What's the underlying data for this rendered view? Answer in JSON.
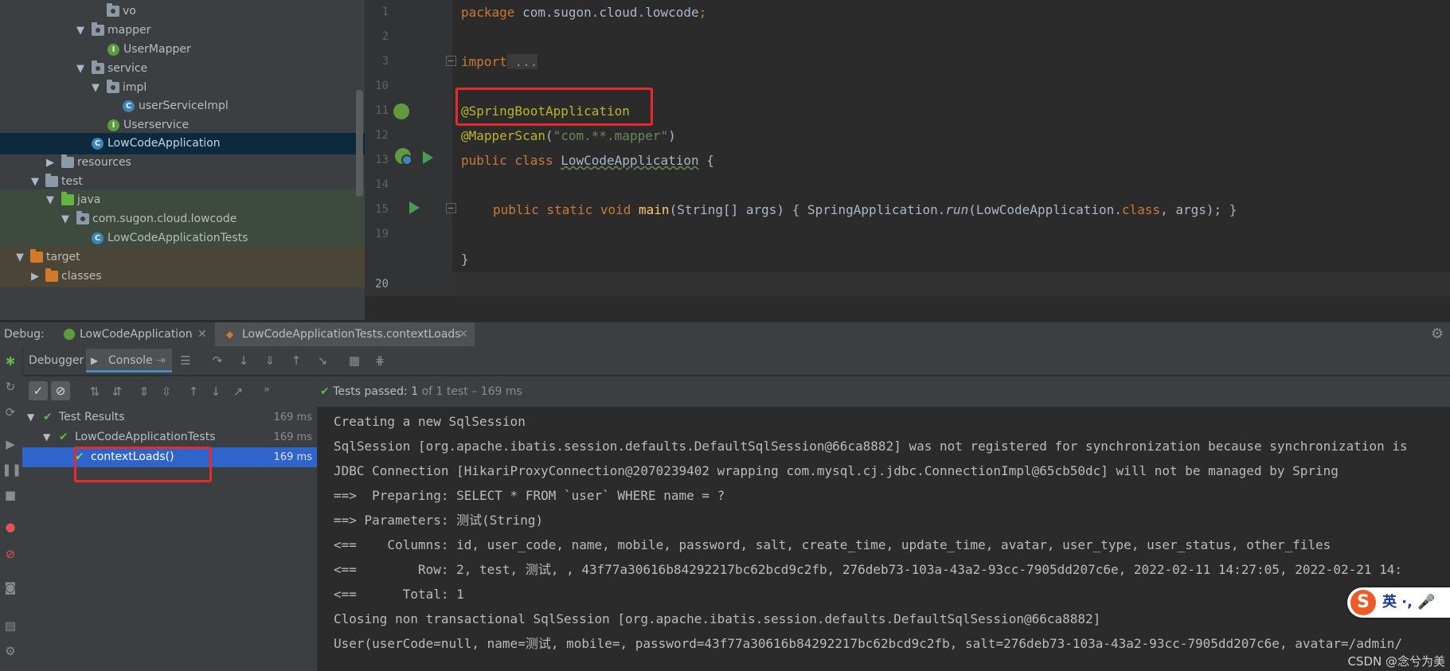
{
  "tree": {
    "items": [
      {
        "label": "vo",
        "icon": "package-folder-icon"
      },
      {
        "label": "mapper",
        "icon": "package-folder-icon"
      },
      {
        "label": "UserMapper",
        "icon": "interface-icon"
      },
      {
        "label": "service",
        "icon": "package-folder-icon"
      },
      {
        "label": "impl",
        "icon": "package-folder-icon"
      },
      {
        "label": "userServiceImpl",
        "icon": "class-icon"
      },
      {
        "label": "Userservice",
        "icon": "interface-icon"
      },
      {
        "label": "LowCodeApplication",
        "icon": "spring-boot-class-icon"
      },
      {
        "label": "resources",
        "icon": "resources-folder-icon"
      },
      {
        "label": "test",
        "icon": "folder-icon"
      },
      {
        "label": "java",
        "icon": "test-source-folder-icon"
      },
      {
        "label": "com.sugon.cloud.lowcode",
        "icon": "package-folder-icon"
      },
      {
        "label": "LowCodeApplicationTests",
        "icon": "spring-boot-class-icon"
      },
      {
        "label": "target",
        "icon": "excluded-folder-icon"
      },
      {
        "label": "classes",
        "icon": "excluded-folder-icon"
      }
    ]
  },
  "editor": {
    "line_numbers": [
      "1",
      "2",
      "3",
      "10",
      "11",
      "12",
      "13",
      "14",
      "15",
      "19",
      "20"
    ],
    "lines": {
      "package_kw": "package",
      "package_name": " com.sugon.cloud.lowcode",
      "semicolon": ";",
      "import_kw": "import",
      "import_folded": " ...",
      "annotation_springboot": "@SpringBootApplication",
      "annotation_mapperscan": "@MapperScan",
      "mapperscan_open": "(",
      "mapperscan_str": "\"com.**.mapper\"",
      "mapperscan_close": ")",
      "class_mods": "public class",
      "class_name": "LowCodeApplication",
      "class_brace": " {",
      "main_mods": "public static void",
      "main_name": "main",
      "main_params": "(String[] args) { SpringApplication.",
      "run_call": "run",
      "main_args_a": "(LowCodeApplication.",
      "class_kw": "class",
      "main_args_b": ", args); }",
      "closing_brace": "}"
    }
  },
  "debug": {
    "label": "Debug:",
    "tabs": [
      "LowCodeApplication",
      "LowCodeApplicationTests.contextLoads"
    ],
    "sub_tabs": {
      "debugger": "Debugger",
      "console": "Console"
    }
  },
  "testbar": {
    "status_prefix": "Tests passed:",
    "status_count": "1",
    "status_of": "of 1 test",
    "status_time": "– 169 ms"
  },
  "results": {
    "rows": [
      {
        "label": "Test Results",
        "time": "169 ms"
      },
      {
        "label": "LowCodeApplicationTests",
        "time": "169 ms"
      },
      {
        "label": "contextLoads()",
        "time": "169 ms"
      }
    ]
  },
  "console": {
    "lines": [
      "Creating a new SqlSession",
      "SqlSession [org.apache.ibatis.session.defaults.DefaultSqlSession@66ca8882] was not registered for synchronization because synchronization is",
      "JDBC Connection [HikariProxyConnection@2070239402 wrapping com.mysql.cj.jdbc.ConnectionImpl@65cb50dc] will not be managed by Spring",
      "==>  Preparing: SELECT * FROM `user` WHERE name = ?",
      "==> Parameters: 测试(String)",
      "<==    Columns: id, user_code, name, mobile, password, salt, create_time, update_time, avatar, user_type, user_status, other_files",
      "<==        Row: 2, test, 测试, , 43f77a30616b84292217bc62bcd9c2fb, 276deb73-103a-43a2-93cc-7905dd207c6e, 2022-02-11 14:27:05, 2022-02-21 14:",
      "<==      Total: 1",
      "Closing non transactional SqlSession [org.apache.ibatis.session.defaults.DefaultSqlSession@66ca8882]",
      "User(userCode=null, name=测试, mobile=, password=43f77a30616b84292217bc62bcd9c2fb, salt=276deb73-103a-43a2-93cc-7905dd207c6e, avatar=/admin/"
    ]
  },
  "ime": {
    "logo": "S",
    "text": "英 ·, 🎤"
  },
  "watermark": "CSDN @念兮为美",
  "colors": {
    "keyword": "#cc7832",
    "annotation": "#bbb529",
    "string": "#6a8759",
    "highlight_box": "#e82a2a",
    "selection": "#2f65ca",
    "pass": "#62b543"
  }
}
